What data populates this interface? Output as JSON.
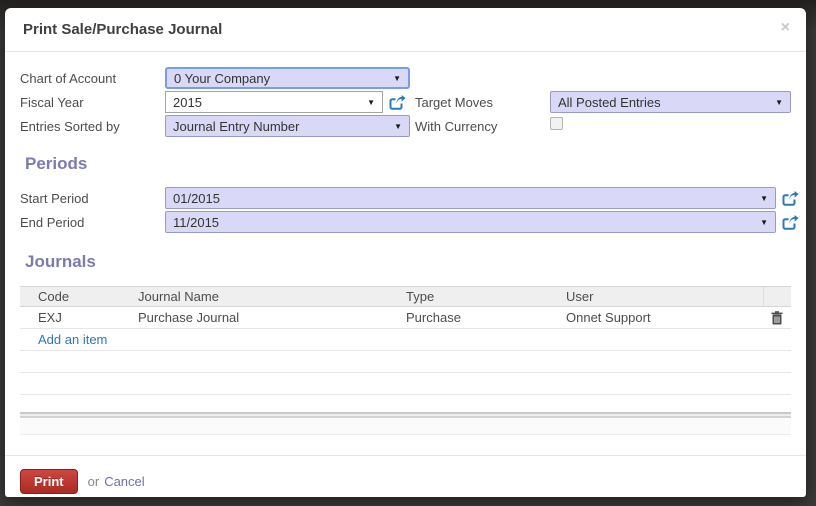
{
  "dialog": {
    "title": "Print Sale/Purchase Journal",
    "close_label": "×"
  },
  "fields": {
    "chart_of_account": {
      "label": "Chart of Account",
      "value": "0 Your Company"
    },
    "fiscal_year": {
      "label": "Fiscal Year",
      "value": "2015"
    },
    "entries_sorted_by": {
      "label": "Entries Sorted by",
      "value": "Journal Entry Number"
    },
    "target_moves": {
      "label": "Target Moves",
      "value": "All Posted Entries"
    },
    "with_currency": {
      "label": "With Currency",
      "checked": false
    }
  },
  "periods": {
    "heading": "Periods",
    "start_period": {
      "label": "Start Period",
      "value": "01/2015"
    },
    "end_period": {
      "label": "End Period",
      "value": "11/2015"
    }
  },
  "journals": {
    "heading": "Journals",
    "columns": [
      "Code",
      "Journal Name",
      "Type",
      "User"
    ],
    "rows": [
      {
        "code": "EXJ",
        "journal_name": "Purchase Journal",
        "type": "Purchase",
        "user": "Onnet Support"
      }
    ],
    "add_item_label": "Add an item"
  },
  "footer": {
    "print_label": "Print",
    "or_label": "or",
    "cancel_label": "Cancel"
  },
  "icons": {
    "dropdown_arrow": "▼"
  },
  "colors": {
    "section_heading": "#7c7bad",
    "field_lavender": "#d9d9f7",
    "focus_border": "#74a0e2",
    "link_blue": "#2b79b5",
    "cancel_purple": "#6f6fb0",
    "print_red": "#b5342d",
    "backdrop_dark": "#3a3836"
  }
}
